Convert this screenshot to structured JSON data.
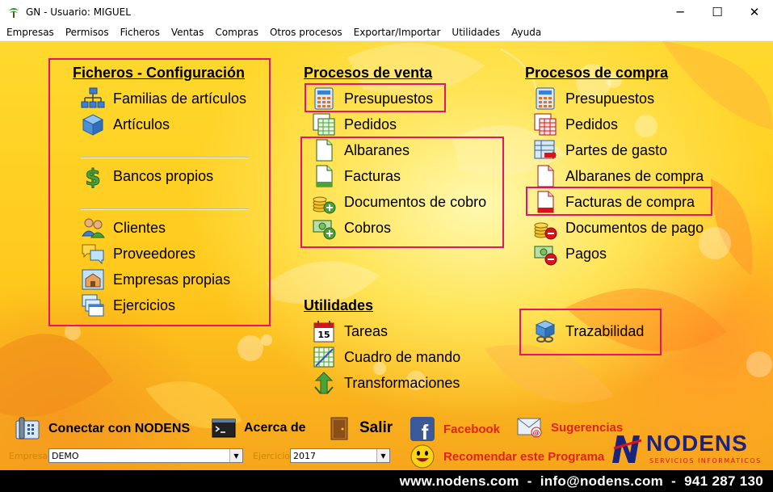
{
  "window": {
    "title": "GN - Usuario: MIGUEL",
    "minimize": "─",
    "maximize": "☐",
    "close": "✕"
  },
  "menu": [
    "Empresas",
    "Permisos",
    "Ficheros",
    "Ventas",
    "Compras",
    "Otros procesos",
    "Exportar/Importar",
    "Utilidades",
    "Ayuda"
  ],
  "ficheros": {
    "title": "Ficheros - Configuración",
    "items": [
      "Familias de artículos",
      "Artículos",
      "Bancos propios",
      "Clientes",
      "Proveedores",
      "Empresas propias",
      "Ejercicios"
    ]
  },
  "ventas": {
    "title": "Procesos de venta",
    "items": [
      "Presupuestos",
      "Pedidos",
      "Albaranes",
      "Facturas",
      "Documentos de cobro",
      "Cobros"
    ]
  },
  "compras": {
    "title": "Procesos de compra",
    "items": [
      "Presupuestos",
      "Pedidos",
      "Partes de gasto",
      "Albaranes de compra",
      "Facturas de compra",
      "Documentos de pago",
      "Pagos"
    ]
  },
  "utilidades": {
    "title": "Utilidades",
    "items": [
      "Tareas",
      "Cuadro de mando",
      "Transformaciones"
    ]
  },
  "trazabilidad": "Trazabilidad",
  "tareas_icon_text": "15",
  "bottom": {
    "conectar": "Conectar con NODENS",
    "acerca": "Acerca de",
    "salir": "Salir",
    "facebook": "Facebook",
    "sugerencias": "Sugerencias",
    "recomendar": "Recomendar este Programa",
    "empresa_label": "Empresa",
    "empresa_value": "DEMO",
    "ejercicio_label": "Ejercicio",
    "ejercicio_value": "2017"
  },
  "logo": {
    "name": "NODENS",
    "tagline": "SERVICIOS INFORMÁTICOS"
  },
  "footer": "www.nodens.com  -  info@nodens.com  -  941 287 130",
  "colors": {
    "highlight": "#e8136c",
    "link_red": "#e2231a",
    "logo_blue": "#1a237e",
    "logo_red": "#d8141a"
  }
}
